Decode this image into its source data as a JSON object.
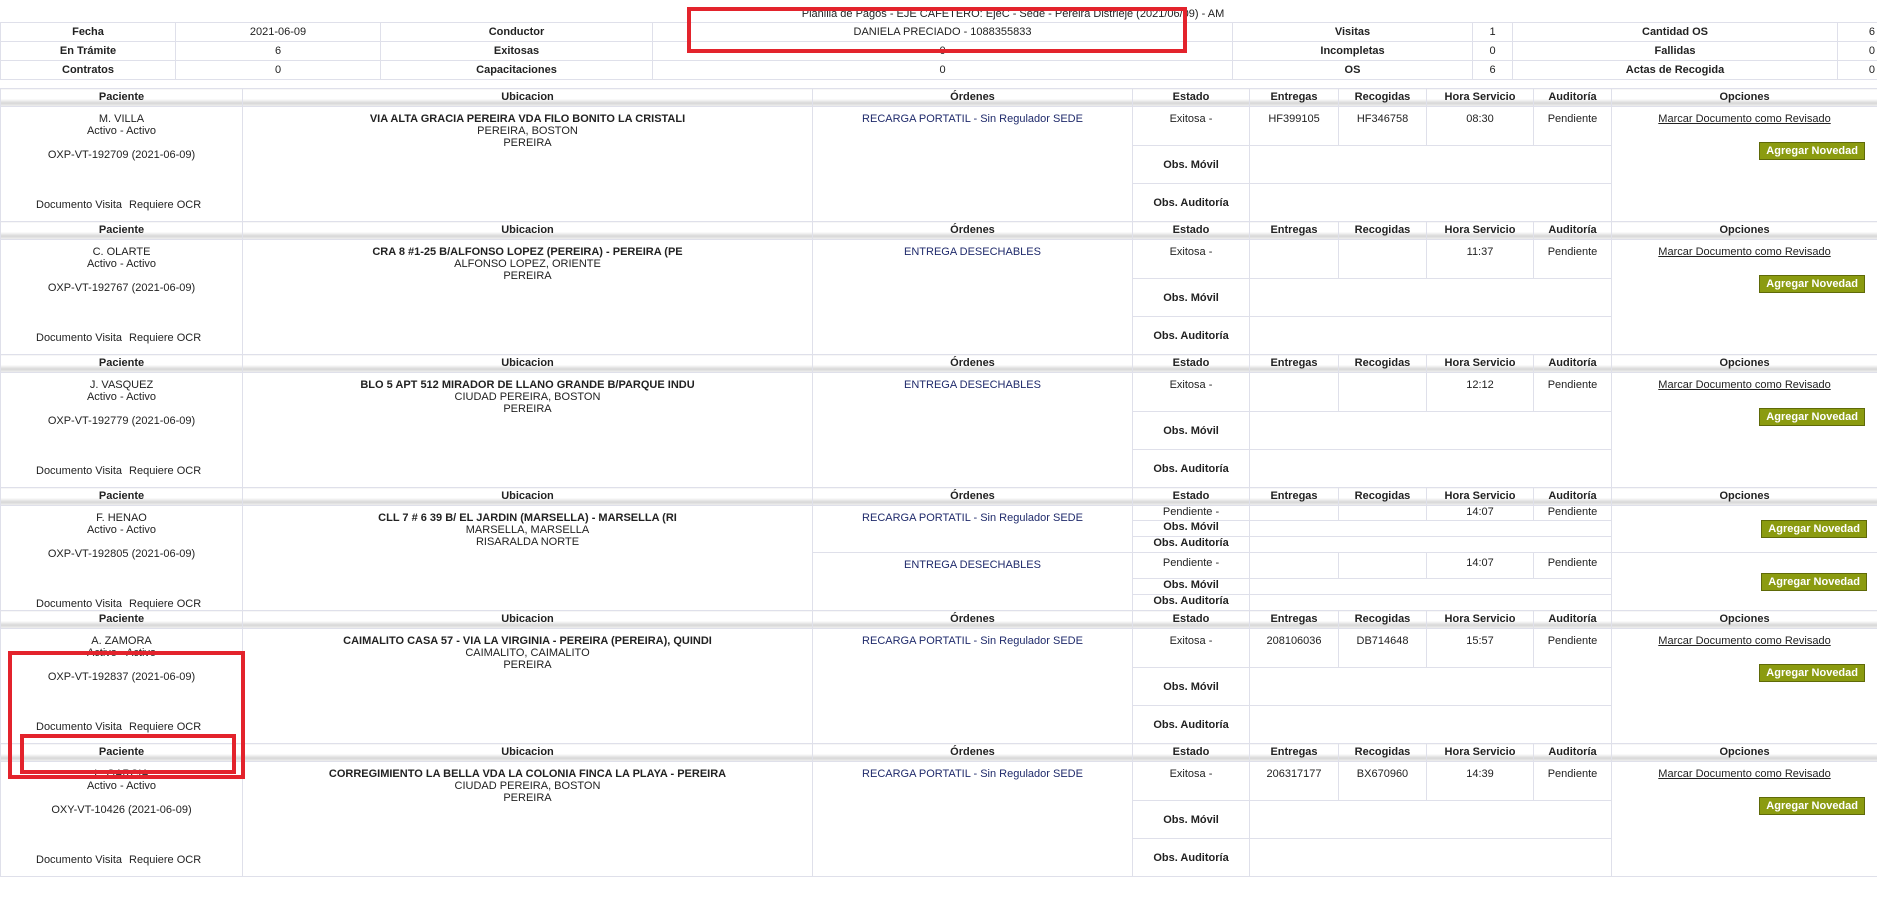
{
  "summary": {
    "title": "Planilla de Pagos - EJE CAFETERO: EjeC - Sede - Pereira Distrieje (2021/06/09) - AM",
    "rows": [
      {
        "k1": "Fecha",
        "v1": "2021-06-09",
        "k2": "Conductor",
        "v2": "DANIELA PRECIADO - 1088355833",
        "k3": "Visitas",
        "v3": "1",
        "k4": "Cantidad OS",
        "v4": "6"
      },
      {
        "k1": "En Trámite",
        "v1": "6",
        "k2": "Exitosas",
        "v2": "0",
        "k3": "Incompletas",
        "v3": "0",
        "k4": "Fallidas",
        "v4": "0"
      },
      {
        "k1": "Contratos",
        "v1": "0",
        "k2": "Capacitaciones",
        "v2": "0",
        "k3": "OS",
        "v3": "6",
        "k4": "Actas de Recogida",
        "v4": "0"
      }
    ]
  },
  "headers": {
    "paciente": "Paciente",
    "ubicacion": "Ubicacion",
    "ordenes": "Órdenes",
    "estado": "Estado",
    "entregas": "Entregas",
    "recogidas": "Recogidas",
    "hora": "Hora Servicio",
    "auditoria": "Auditoría",
    "opciones": "Opciones"
  },
  "labels": {
    "obs_movil": "Obs. Móvil",
    "obs_auditoria": "Obs. Auditoría",
    "documento_visita": "Documento Visita",
    "requiere_ocr": "Requiere OCR",
    "marcar": "Marcar Documento como Revisado",
    "agregar": "Agregar Novedad"
  },
  "records": [
    {
      "name": "M. VILLA",
      "status": "Activo - Activo",
      "code": "OXP-VT-192709 (2021-06-09)",
      "ubi1": "VIA ALTA GRACIA PEREIRA VDA FILO BONITO LA CRISTALI",
      "ubi2": "PEREIRA, BOSTON",
      "ubi3": "PEREIRA",
      "orden": "RECARGA PORTATIL - Sin Regulador SEDE",
      "estado": "Exitosa -",
      "entregas": "HF399105",
      "recogidas": "HF346758",
      "hora": "08:30",
      "auditoria": "Pendiente"
    },
    {
      "name": "C. OLARTE",
      "status": "Activo - Activo",
      "code": "OXP-VT-192767 (2021-06-09)",
      "ubi1": "CRA 8 #1-25 B/ALFONSO LOPEZ (PEREIRA) - PEREIRA (PE",
      "ubi2": "ALFONSO LOPEZ, ORIENTE",
      "ubi3": "PEREIRA",
      "orden": "ENTREGA DESECHABLES",
      "estado": "Exitosa -",
      "entregas": "",
      "recogidas": "",
      "hora": "11:37",
      "auditoria": "Pendiente"
    },
    {
      "name": "J. VASQUEZ",
      "status": "Activo - Activo",
      "code": "OXP-VT-192779 (2021-06-09)",
      "ubi1": "BLO 5 APT 512 MIRADOR DE LLANO GRANDE B/PARQUE INDU",
      "ubi2": "CIUDAD PEREIRA, BOSTON",
      "ubi3": "PEREIRA",
      "orden": "ENTREGA DESECHABLES",
      "estado": "Exitosa -",
      "entregas": "",
      "recogidas": "",
      "hora": "12:12",
      "auditoria": "Pendiente"
    },
    {
      "name": "F. HENAO",
      "status": "Activo - Activo",
      "code": "OXP-VT-192805 (2021-06-09)",
      "ubi1": "CLL 7 # 6 39 B/ EL JARDIN (MARSELLA) - MARSELLA (RI",
      "ubi2": "MARSELLA, MARSELLA",
      "ubi3": "RISARALDA NORTE",
      "orden": "RECARGA PORTATIL - Sin Regulador SEDE",
      "estado": "Pendiente -",
      "entregas": "",
      "recogidas": "",
      "hora": "14:07",
      "auditoria": "Pendiente",
      "orden2": "ENTREGA DESECHABLES",
      "estado2": "Pendiente -",
      "hora2": "14:07",
      "auditoria2": "Pendiente"
    },
    {
      "name": "A. ZAMORA",
      "status": "Activo - Activo",
      "code": "OXP-VT-192837 (2021-06-09)",
      "ubi1": "CAIMALITO CASA 57 - VIA LA VIRGINIA - PEREIRA (PEREIRA), QUINDI",
      "ubi2": "CAIMALITO, CAIMALITO",
      "ubi3": "PEREIRA",
      "orden": "RECARGA PORTATIL - Sin Regulador SEDE",
      "estado": "Exitosa -",
      "entregas": "208106036",
      "recogidas": "DB714648",
      "hora": "15:57",
      "auditoria": "Pendiente"
    },
    {
      "name": "L. GARCIA",
      "status": "Activo - Activo",
      "code": "OXY-VT-10426 (2021-06-09)",
      "ubi1": "CORREGIMIENTO LA BELLA VDA LA COLONIA FINCA LA PLAYA - PEREIRA",
      "ubi2": "CIUDAD PEREIRA, BOSTON",
      "ubi3": "PEREIRA",
      "orden": "RECARGA PORTATIL - Sin Regulador SEDE",
      "estado": "Exitosa -",
      "entregas": "206317177",
      "recogidas": "BX670960",
      "hora": "14:39",
      "auditoria": "Pendiente"
    }
  ],
  "colors": {
    "highlight_row": "#fafbd3",
    "button": "#8b9b10",
    "annotation_box": "#e3232c"
  }
}
